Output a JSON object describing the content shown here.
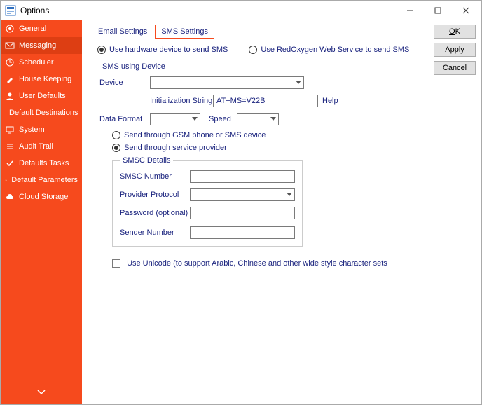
{
  "window": {
    "title": "Options"
  },
  "win_buttons": {
    "min": "—",
    "max": "□",
    "close": "✕"
  },
  "sidebar": {
    "items": [
      {
        "label": "General"
      },
      {
        "label": "Messaging"
      },
      {
        "label": "Scheduler"
      },
      {
        "label": "House Keeping"
      },
      {
        "label": "User Defaults"
      },
      {
        "label": "Default Destinations"
      },
      {
        "label": "System"
      },
      {
        "label": "Audit Trail"
      },
      {
        "label": "Defaults Tasks"
      },
      {
        "label": "Default Parameters"
      },
      {
        "label": "Cloud Storage"
      }
    ]
  },
  "buttons": {
    "ok": "OK",
    "apply": "Apply",
    "cancel": "Cancel"
  },
  "tabs": {
    "email": "Email Settings",
    "sms": "SMS Settings"
  },
  "sendmode": {
    "hardware": "Use hardware device to send SMS",
    "redoxygen": "Use RedOxygen Web Service  to send SMS"
  },
  "group_device_title": "SMS using Device",
  "device": {
    "label": "Device",
    "value": "",
    "init_label": "Initialization String",
    "init_value": "AT+MS=V22B",
    "help": "Help"
  },
  "dataformat": {
    "label": "Data Format",
    "value": "",
    "speed_label": "Speed",
    "speed_value": ""
  },
  "through": {
    "gsm": "Send through GSM phone or SMS device",
    "provider": "Send through service provider"
  },
  "smsc": {
    "title": "SMSC Details",
    "number_label": "SMSC Number",
    "number_value": "",
    "protocol_label": "Provider Protocol",
    "protocol_value": "",
    "password_label": "Password (optional)",
    "password_value": "",
    "sender_label": "Sender Number",
    "sender_value": ""
  },
  "unicode": {
    "label": "Use Unicode (to support Arabic, Chinese and other wide style character sets"
  }
}
